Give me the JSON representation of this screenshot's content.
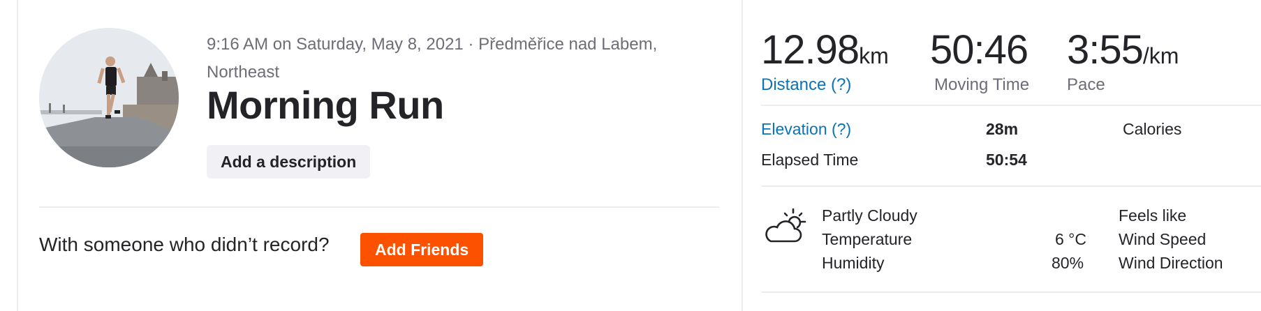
{
  "activity": {
    "meta": "9:16 AM on Saturday, May 8, 2021 · Předměřice nad Labem, Northeast",
    "title": "Morning Run",
    "add_description_label": "Add a description"
  },
  "friends": {
    "prompt": "With someone who didn’t record?",
    "button_label": "Add Friends"
  },
  "primary_stats": {
    "distance": {
      "value": "12.98",
      "unit": "km",
      "label": "Distance (?)"
    },
    "moving_time": {
      "value": "50:46",
      "label": "Moving Time"
    },
    "pace": {
      "value": "3:55",
      "unit": "/km",
      "label": "Pace"
    }
  },
  "secondary_stats": {
    "elevation": {
      "label": "Elevation (?)",
      "value": "28m"
    },
    "calories": {
      "label": "Calories"
    },
    "elapsed_time": {
      "label": "Elapsed Time",
      "value": "50:54"
    }
  },
  "weather": {
    "icon": "partly-cloudy-icon",
    "condition": "Partly Cloudy",
    "temperature_label": "Temperature",
    "temperature_value": "6 °C",
    "humidity_label": "Humidity",
    "humidity_value": "80%",
    "feels_like_label": "Feels like",
    "wind_speed_label": "Wind Speed",
    "wind_direction_label": "Wind Direction"
  },
  "colors": {
    "accent_orange": "#fc5200",
    "link_blue": "#0a73b5",
    "text_primary": "#242428",
    "text_secondary": "#6d6d78"
  }
}
